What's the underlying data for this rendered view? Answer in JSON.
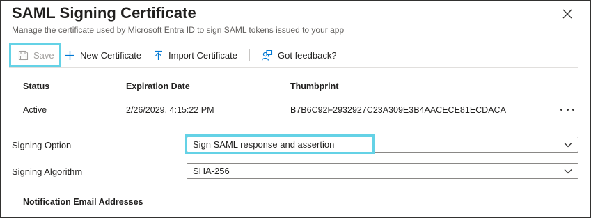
{
  "panel": {
    "title": "SAML Signing Certificate",
    "subtitle": "Manage the certificate used by Microsoft Entra ID to sign SAML tokens issued to your app",
    "close_icon": "close-icon"
  },
  "toolbar": {
    "save_label": "Save",
    "new_certificate_label": "New Certificate",
    "import_certificate_label": "Import Certificate",
    "feedback_label": "Got feedback?",
    "save_icon": "floppy-disk-icon",
    "new_icon": "plus-icon",
    "import_icon": "upload-arrow-icon",
    "feedback_icon": "person-feedback-icon"
  },
  "certificates": {
    "columns": [
      "Status",
      "Expiration Date",
      "Thumbprint"
    ],
    "rows": [
      {
        "status": "Active",
        "expiration": "2/26/2029, 4:15:22 PM",
        "thumbprint": "B7B6C92F2932927C23A309E3B4AACECE81ECDACA"
      }
    ]
  },
  "signing_option": {
    "label": "Signing Option",
    "value": "Sign SAML response and assertion"
  },
  "signing_algorithm": {
    "label": "Signing Algorithm",
    "value": "SHA-256"
  },
  "notification": {
    "heading": "Notification Email Addresses"
  },
  "colors": {
    "highlight": "#64d2e6",
    "text": "#201f1e",
    "muted": "#605e5c",
    "disabled": "#a19f9d",
    "accent": "#0078d4"
  }
}
